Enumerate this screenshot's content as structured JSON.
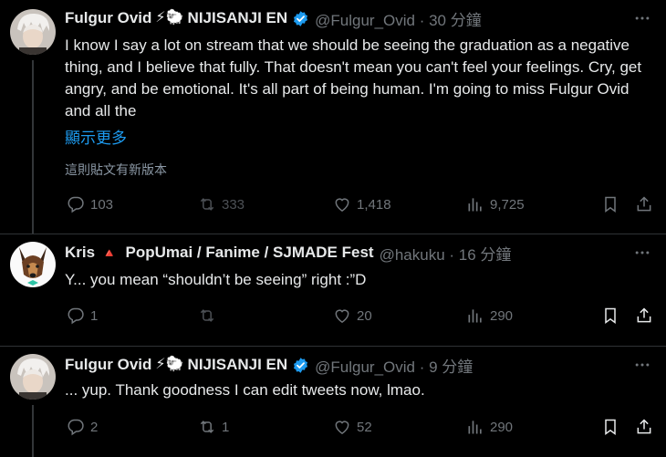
{
  "tweets": [
    {
      "name": "Fulgur Ovid",
      "emoji": "⚡🐑",
      "org": "NIJISANJI EN",
      "handle_time": "@Fulgur_Ovid · 30 分鐘",
      "text": "I know I say a lot on stream that we should be seeing the graduation as a negative thing, and I believe that fully. That doesn't mean you can't feel your feelings. Cry, get angry, and be emotional. It's all part of being human.  I'm going to miss Fulgur Ovid and all the",
      "show_more": "顯示更多",
      "edited": "這則貼文有新版本",
      "replies": "103",
      "retweets": "333",
      "likes": "1,418",
      "views": "9,725"
    },
    {
      "name": "Kris",
      "emoji": "🔺",
      "org": "PopUmai / Fanime / SJMADE Fest",
      "handle_time": "@hakuku · 16 分鐘",
      "text": "Y... you mean “shouldn’t be seeing” right :”D",
      "replies": "1",
      "retweets": "",
      "likes": "20",
      "views": "290"
    },
    {
      "name": "Fulgur Ovid",
      "emoji": "⚡🐑",
      "org": "NIJISANJI EN",
      "handle_time": "@Fulgur_Ovid · 9 分鐘",
      "text": "... yup. Thank goodness I can edit tweets now, lmao.",
      "replies": "2",
      "retweets": "1",
      "likes": "52",
      "views": "290"
    }
  ],
  "colors": {
    "accent": "#1d9bf0",
    "muted": "#71767b",
    "background": "#000000"
  },
  "icons": [
    "reply-icon",
    "retweet-icon",
    "like-icon",
    "views-icon",
    "bookmark-icon",
    "share-icon",
    "more-icon",
    "verified-badge-icon"
  ]
}
